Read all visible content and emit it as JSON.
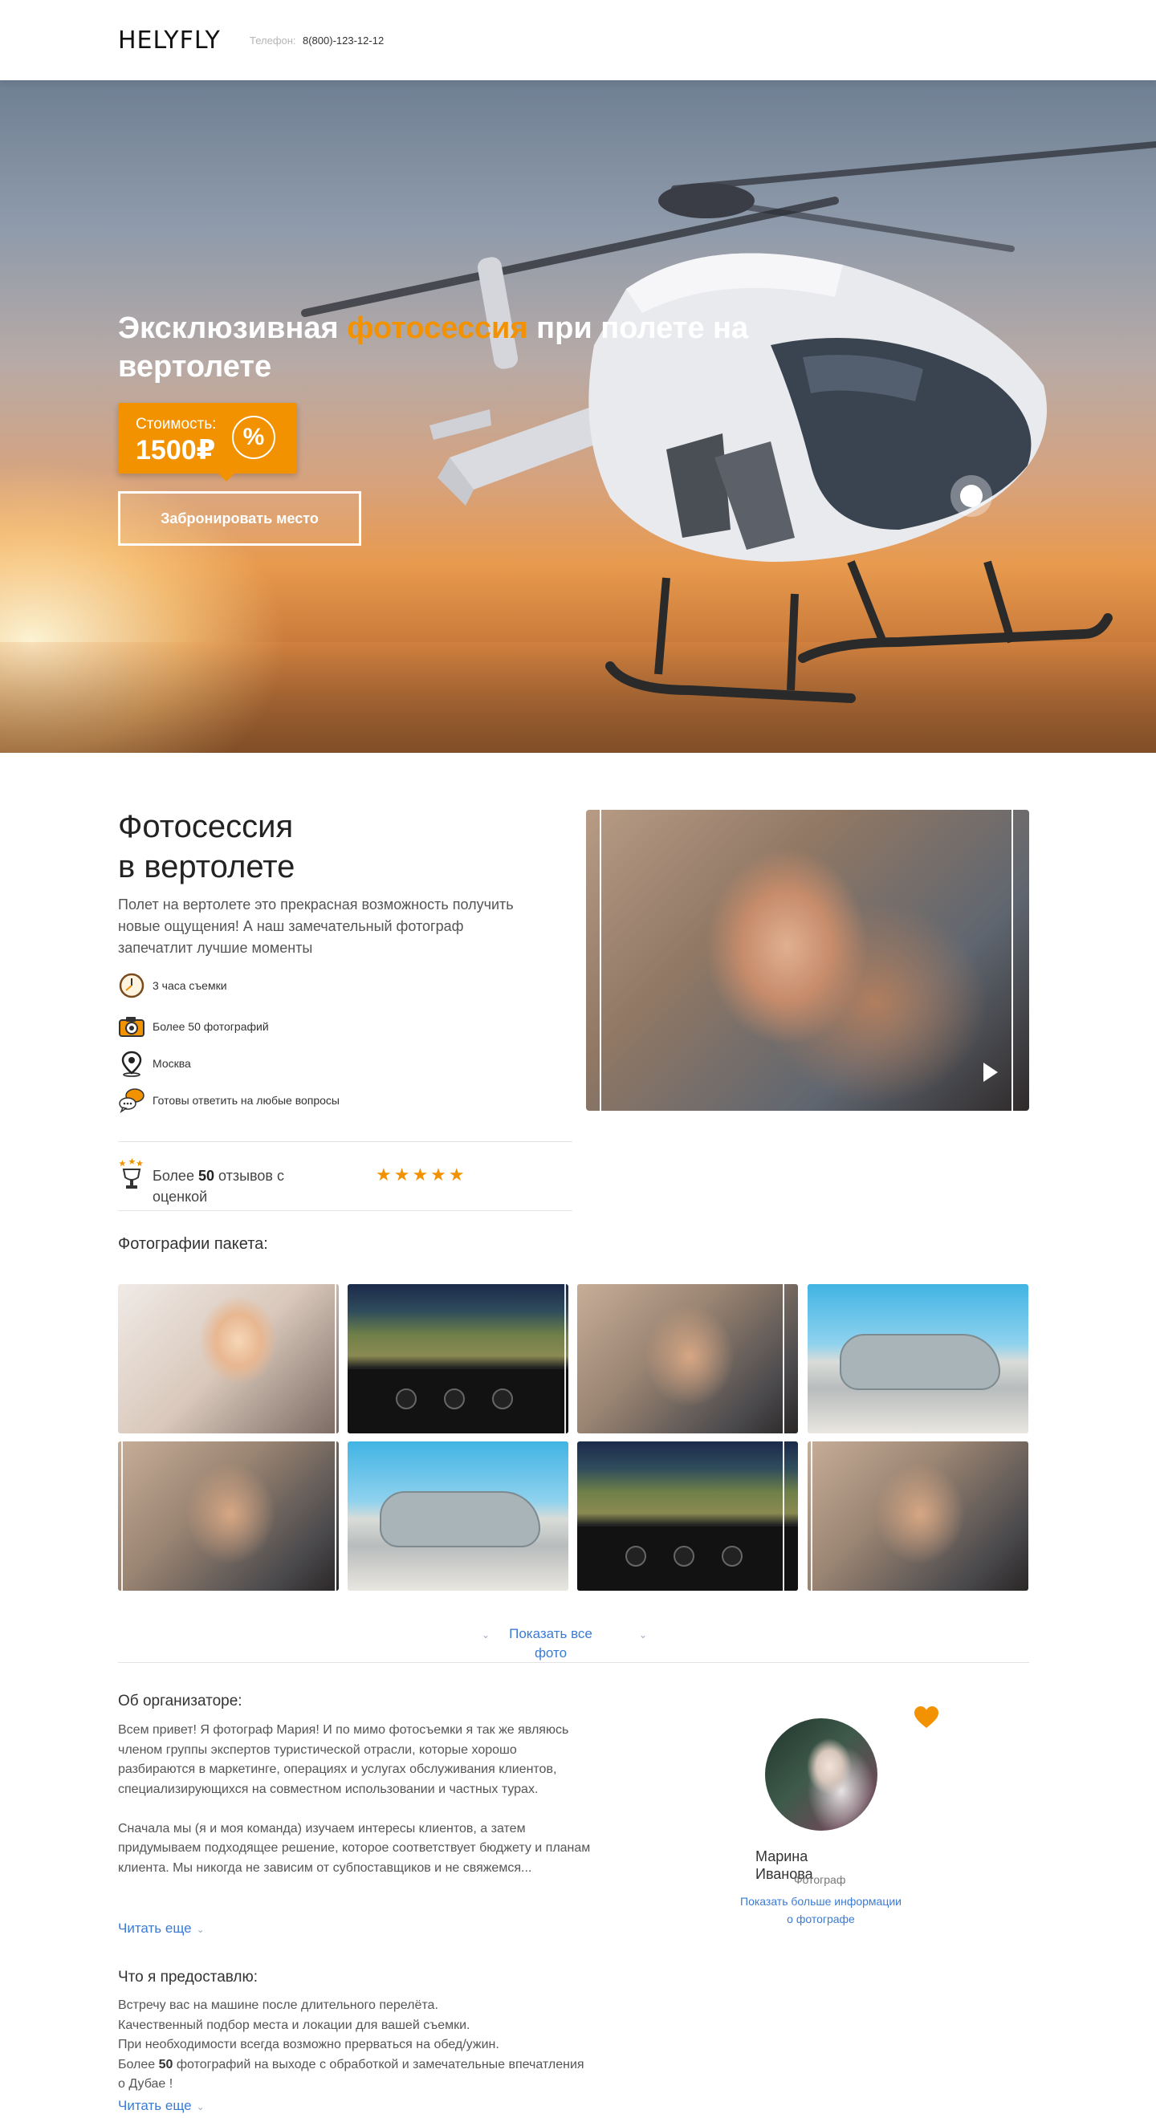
{
  "header": {
    "logo": "HELYFLY",
    "phone_label": "Телефон:",
    "phone_number": "8(800)-123-12-12"
  },
  "hero": {
    "title_part1": "Эксклюзивная ",
    "title_accent": "фотосессия",
    "title_part2": " при полете на вертолете",
    "price_label": "Стоимость:",
    "price_value": "1500₽",
    "percent_symbol": "%",
    "book_button": "Забронировать место",
    "accent_color": "#f39200"
  },
  "intro": {
    "title_line1": "Фотосессия",
    "title_line2": "в вертолете",
    "description": "Полет на вертолете это прекрасная возможность получить новые ощущения! А наш замечательный фотограф запечатлит лучшие моменты",
    "features": [
      {
        "icon": "clock-icon",
        "text": "3 часа съемки"
      },
      {
        "icon": "camera-icon",
        "text": "Более 50 фотографий"
      },
      {
        "icon": "location-pin-icon",
        "text": "Москва"
      },
      {
        "icon": "chat-bubbles-icon",
        "text": "Готовы ответить на любые вопросы"
      }
    ],
    "reviews_prefix": "Более ",
    "reviews_count": "50",
    "reviews_suffix": " отзывов с оценкой",
    "stars": "★★★★★",
    "star_rating": 5,
    "star_color": "#f39200"
  },
  "gallery": {
    "heading": "Фотографии пакета:",
    "show_all": "Показать все фото"
  },
  "organizer": {
    "heading": "Об организаторе:",
    "paragraph1": "Всем привет! Я фотограф Мария! И по мимо фотосъемки я так же являюсь членом группы экспертов туристической отрасли, которые хорошо разбираются в маркетинге, операциях и услугах обслуживания клиентов, специализирующихся на совместном использовании и частных турах.",
    "paragraph2": "Сначала мы (я и моя команда) изучаем интересы клиентов, а затем придумываем подходящее решение, которое соответствует бюджету и планам клиента. Мы никогда не зависим от субпоставщиков и не свяжемся...",
    "read_more": "Читать еще",
    "photographer_name": "Марина Иванова",
    "photographer_role": "Фотограф",
    "photographer_more": "Показать больше информации о фотографе"
  },
  "provide": {
    "heading": "Что я предоставлю:",
    "line1": "Встречу вас на машине после длительного перелёта.",
    "line2": "Качественный подбор места и локации для вашей съемки.",
    "line3": "При необходимости всегда возможно прерваться на обед/ужин.",
    "line4_prefix": "Более ",
    "line4_bold": "50",
    "line4_suffix": " фотографий на выходе с обработкой и замечательные впечатления о Дубае !",
    "read_more": "Читать еще"
  }
}
